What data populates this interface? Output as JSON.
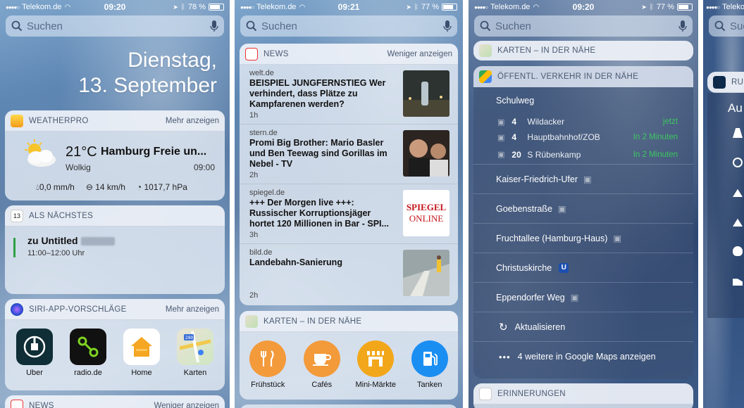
{
  "screens": [
    {
      "status": {
        "carrier": "Telekom.de",
        "time": "09:20",
        "battery": "78 %",
        "battery_fill": 0.78
      },
      "search": {
        "placeholder": "Suchen"
      },
      "date": {
        "weekday": "Dienstag,",
        "day": "13. September"
      },
      "weather": {
        "title": "WEATHERPRO",
        "action": "Mehr anzeigen",
        "temp": "21°C",
        "city": "Hamburg Freie un...",
        "condition": "Wolkig",
        "time": "09:00",
        "rain": "0,0 mm/h",
        "wind": "14 km/h",
        "pressure": "1017,7 hPa"
      },
      "calendar": {
        "title": "ALS NÄCHSTES",
        "icon_day": "13",
        "event": "zu Untitled",
        "time": "11:00–12:00 Uhr"
      },
      "siri": {
        "title": "SIRI-APP-VORSCHLÄGE",
        "action": "Mehr anzeigen",
        "apps": [
          {
            "label": "Uber",
            "icon": "uber-icon"
          },
          {
            "label": "radio.de",
            "icon": "radio-icon"
          },
          {
            "label": "Home",
            "icon": "home-icon"
          },
          {
            "label": "Karten",
            "icon": "maps-icon"
          }
        ]
      },
      "news_peek": {
        "title": "NEWS",
        "action": "Weniger anzeigen"
      }
    },
    {
      "status": {
        "carrier": "Telekom.de",
        "time": "09:21",
        "battery": "77 %",
        "battery_fill": 0.77
      },
      "search": {
        "placeholder": "Suchen"
      },
      "news": {
        "title": "NEWS",
        "action": "Weniger anzeigen",
        "items": [
          {
            "source": "welt.de",
            "headline": "BEISPIEL JUNGFERNSTIEG Wer verhindert, dass Plätze zu Kampfarenen werden?",
            "ago": "1h"
          },
          {
            "source": "stern.de",
            "headline": "Promi Big Brother: Mario Basler und Ben Teewag sind Gorillas im Nebel - TV",
            "ago": "2h"
          },
          {
            "source": "spiegel.de",
            "headline": "+++ Der Morgen live +++: Russischer Korruptionsjäger hortet 120 Millionen in Bar - SPI...",
            "ago": "3h",
            "logo_top": "SPIEGEL",
            "logo_bottom": "ONLINE"
          },
          {
            "source": "bild.de",
            "headline": "Landebahn-Sanierung",
            "ago": "2h"
          }
        ]
      },
      "maps": {
        "title": "KARTEN – IN DER NÄHE",
        "categories": [
          {
            "label": "Frühstück",
            "icon": "fork-knife-icon",
            "color": "#f39a3b"
          },
          {
            "label": "Cafés",
            "icon": "coffee-cup-icon",
            "color": "#f39a3b"
          },
          {
            "label": "Mini-Märkte",
            "icon": "shop-icon",
            "color": "#f2a71b"
          },
          {
            "label": "Tanken",
            "icon": "fuel-pump-icon",
            "color": "#1b8ef2"
          }
        ]
      }
    },
    {
      "status": {
        "carrier": "Telekom.de",
        "time": "09:20",
        "battery": "77 %",
        "battery_fill": 0.77
      },
      "search": {
        "placeholder": "Suchen"
      },
      "maps_collapsed": {
        "title": "KARTEN – IN DER NÄHE"
      },
      "transit": {
        "title": "ÖFFENTL. VERKEHR IN DER NÄHE",
        "first_stop": "Schulweg",
        "departures": [
          {
            "line": "4",
            "dest": "Wildacker",
            "when": "jetzt"
          },
          {
            "line": "4",
            "dest": "Hauptbahnhof/ZOB",
            "when": "In 2 Minuten"
          },
          {
            "line": "20",
            "dest": "S Rübenkamp",
            "when": "In 2 Minuten"
          }
        ],
        "stops": [
          {
            "name": "Kaiser-Friedrich-Ufer"
          },
          {
            "name": "Goebenstraße"
          },
          {
            "name": "Fruchtallee (Hamburg-Haus)"
          },
          {
            "name": "Christuskirche",
            "badge": "U"
          },
          {
            "name": "Eppendorfer Weg"
          }
        ],
        "refresh": "Aktualisieren",
        "more": "4 weitere in Google Maps anzeigen"
      },
      "reminders": {
        "title": "ERINNERUNGEN"
      }
    },
    {
      "status": {
        "carrier": "Telekom.de"
      },
      "search": {
        "placeholder": "Suc"
      },
      "card": {
        "title": "RUN",
        "text": "Au"
      }
    }
  ]
}
